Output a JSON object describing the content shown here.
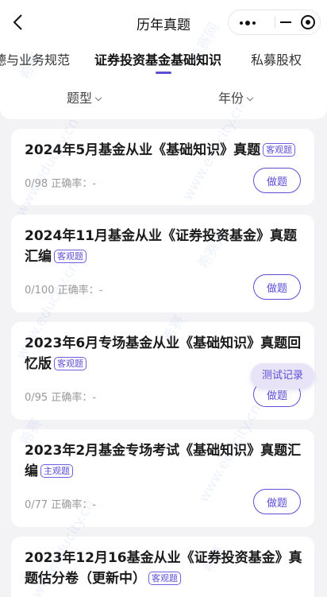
{
  "nav": {
    "title": "历年真题"
  },
  "tabs": [
    {
      "label": "德与业务规范"
    },
    {
      "label": "证券投资基金基础知识"
    },
    {
      "label": "私募股权"
    }
  ],
  "filters": {
    "type_label": "题型",
    "year_label": "年份"
  },
  "cards": [
    {
      "title": "2024年5月基金从业《基础知识》真题",
      "tag": "客观题",
      "meta": "0/98 正确率：-",
      "button": "做题"
    },
    {
      "title": "2024年11月基金从业《证券投资基金》真题汇编",
      "tag": "客观题",
      "meta": "0/100 正确率：-",
      "button": "做题"
    },
    {
      "title": "2023年6月专场基金从业《基础知识》真题回忆版",
      "tag": "客观题",
      "meta": "0/95 正确率：-",
      "button": "做题"
    },
    {
      "title": "2023年2月基金专场考试《基础知识》真题汇编",
      "tag": "主观题",
      "meta": "0/77 正确率：-",
      "button": "做题"
    },
    {
      "title": "2023年12月16基金从业《证券投资基金》真题估分卷（更新中）",
      "tag": "客观题",
      "meta": "",
      "button": ""
    }
  ],
  "float_button": "测试记录",
  "watermark": {
    "brand": "希赛",
    "brand_net": "希赛网",
    "url": "www.educity.cn"
  },
  "colors": {
    "accent": "#5b4fd6",
    "background": "#f3f3f6"
  }
}
